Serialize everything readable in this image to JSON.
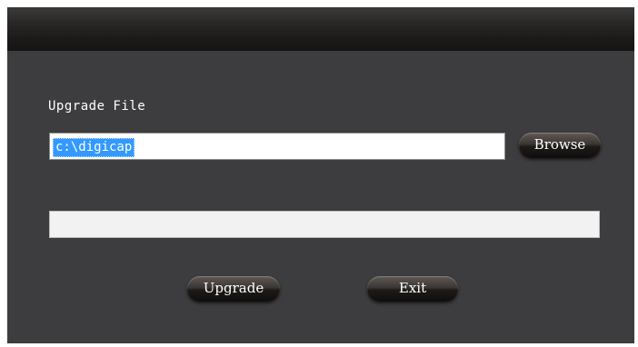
{
  "upgrade_file": {
    "label": "Upgrade File",
    "path_value": "c:\\digicap",
    "browse_label": "Browse"
  },
  "progress": {
    "value": 0
  },
  "actions": {
    "upgrade_label": "Upgrade",
    "exit_label": "Exit"
  }
}
